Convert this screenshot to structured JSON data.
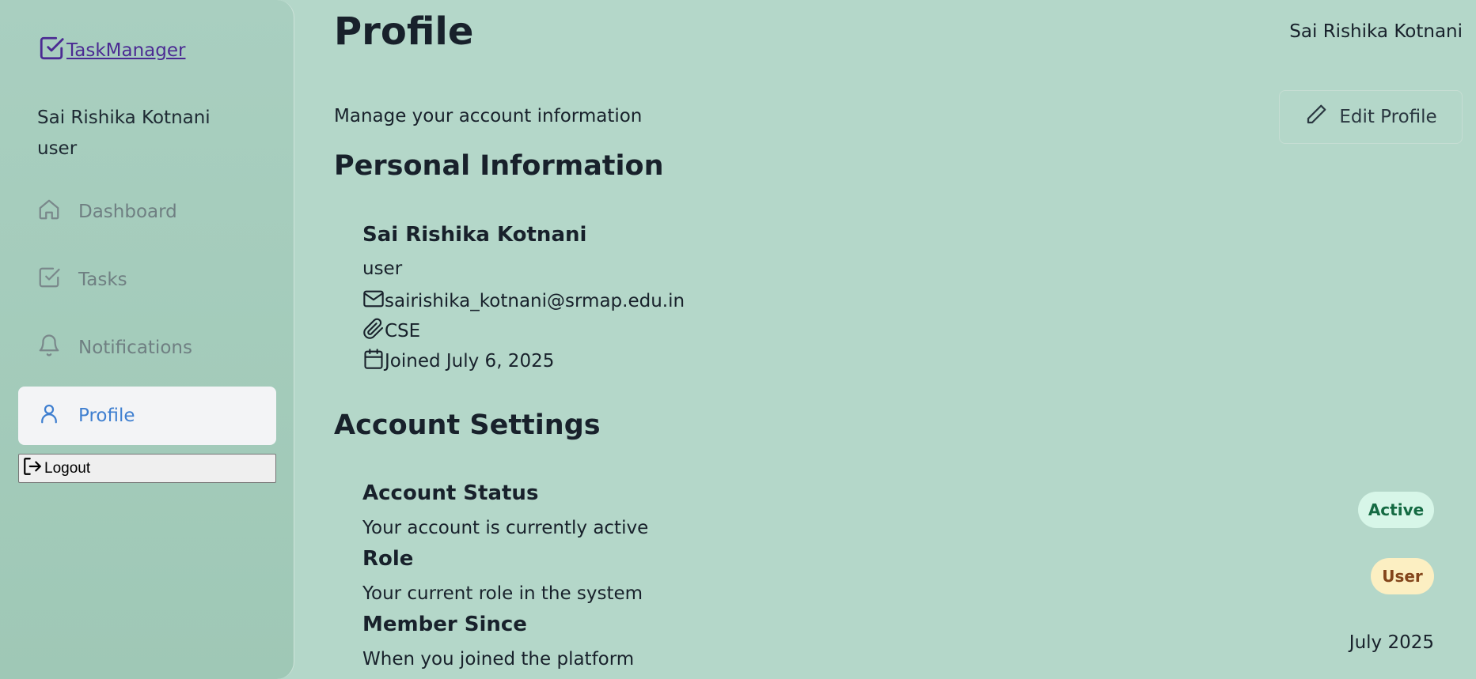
{
  "sidebar": {
    "brand": "TaskManager",
    "user_name": "Sai Rishika Kotnani",
    "user_role": "user",
    "nav": [
      {
        "label": "Dashboard",
        "icon": "home-icon"
      },
      {
        "label": "Tasks",
        "icon": "checkbox-icon"
      },
      {
        "label": "Notifications",
        "icon": "bell-icon"
      },
      {
        "label": "Profile",
        "icon": "user-icon",
        "active": true
      }
    ],
    "logout_label": "Logout"
  },
  "header": {
    "title": "Profile",
    "user_name": "Sai Rishika Kotnani",
    "subtitle": "Manage your account information",
    "edit_label": "Edit Profile"
  },
  "personal": {
    "section_title": "Personal Information",
    "name": "Sai Rishika Kotnani",
    "role": "user",
    "email": "sairishika_kotnani@srmap.edu.in",
    "department": "CSE",
    "joined": "Joined July 6, 2025"
  },
  "settings": {
    "section_title": "Account Settings",
    "status_title": "Account Status",
    "status_desc": "Your account is currently active",
    "status_badge": "Active",
    "role_title": "Role",
    "role_desc": "Your current role in the system",
    "role_badge": "User",
    "member_title": "Member Since",
    "member_desc": "When you joined the platform",
    "member_value": "July 2025"
  },
  "colors": {
    "background": "#b4d7c9",
    "sidebar": "#a3cbbb",
    "brand": "#4b2a93",
    "active_nav": "#3f7fd0",
    "active_badge_bg": "#d7f6e8",
    "user_badge_bg": "#fcefc2"
  }
}
